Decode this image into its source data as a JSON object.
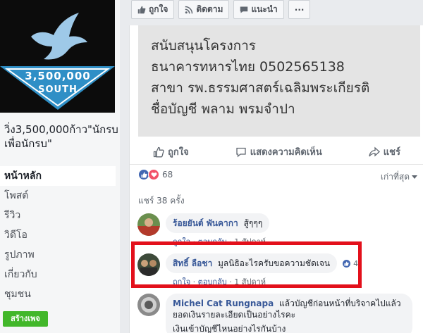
{
  "sidebar": {
    "cover": {
      "number": "3,500,000",
      "south": "SOUTH"
    },
    "page_name": "วิ่ง3,500,000ก้าว\"นักรบเพื่อนักรบ\"",
    "nav": [
      {
        "label": "หน้าหลัก"
      },
      {
        "label": "โพสต์"
      },
      {
        "label": "รีวิว"
      },
      {
        "label": "วิดีโอ"
      },
      {
        "label": "รูปภาพ"
      },
      {
        "label": "เกี่ยวกับ"
      },
      {
        "label": "ชุมชน"
      }
    ],
    "create_page": "สร้างเพจ"
  },
  "page_actions": {
    "like": "ถูกใจ",
    "follow": "ติดตาม",
    "recommend": "แนะนำ",
    "more": "···"
  },
  "post": {
    "image_text": [
      "สนับสนุนโครงการ",
      "ธนาคารทหารไทย 0502565138",
      "สาขา รพ.ธรรมศาสตร์เฉลิมพระเกียรติ",
      "ชื่อบัญชี  พลาม  พรมจำปา"
    ],
    "actions": {
      "like": "ถูกใจ",
      "comment": "แสดงความคิดเห็น",
      "share": "แชร์"
    },
    "reaction_count": "68",
    "sort": "เก่าที่สุด",
    "shares": "แชร์ 38 ครั้ง"
  },
  "comments": [
    {
      "author": "ร้อยยันต์ พันคากา",
      "text": "สู้ๆๆๆ",
      "like": "ถูกใจ",
      "reply": "ตอบกลับ",
      "time": "1 สัปดาห์"
    },
    {
      "author": "สิทธิ์ ลือชา",
      "text": "มูลนิธิอะไรครับขอความชัดเจน",
      "like": "ถูกใจ",
      "reply": "ตอบกลับ",
      "time": "1 สัปดาห์",
      "likes": "4"
    },
    {
      "author": "Michel Cat Rungnapa",
      "text": "แล้วบัญชีก่อนหน้าที่บริจาคไปแล้ว ยอดเงินรายละเอียดเป็นอย่างไรคะ",
      "text2": "เงินเข้าบัญชีไหนอย่างไรกันบ้าง"
    }
  ],
  "colors": {
    "accent": "#4267b2",
    "highlight": "#e3101b",
    "create_button": "#42b72a"
  }
}
